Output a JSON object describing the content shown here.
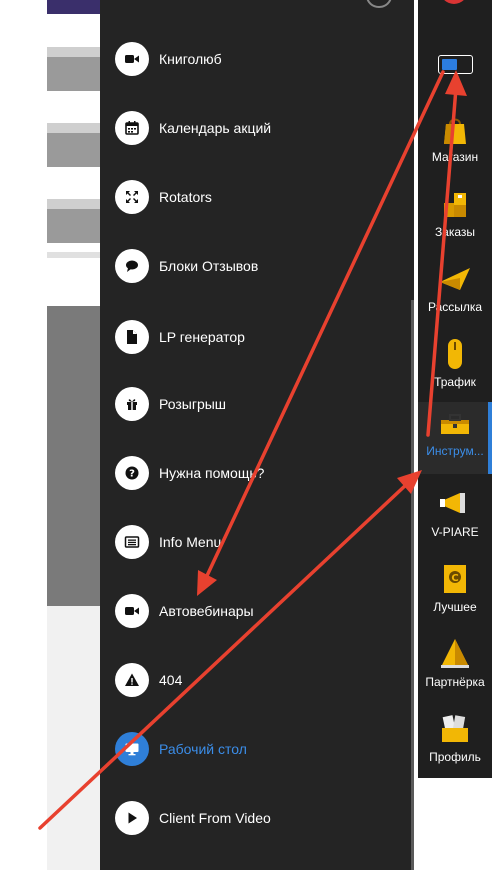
{
  "menu": {
    "items": [
      {
        "label": "Книголюб",
        "icon": "video-camera-icon"
      },
      {
        "label": "Календарь акций",
        "icon": "calendar-icon"
      },
      {
        "label": "Rotators",
        "icon": "expand-arrows-icon"
      },
      {
        "label": "Блоки Отзывов",
        "icon": "comments-icon"
      },
      {
        "label": "LP генератор",
        "icon": "file-icon"
      },
      {
        "label": "Розыгрыш",
        "icon": "gift-icon"
      },
      {
        "label": "Нужна помощь?",
        "icon": "question-icon"
      },
      {
        "label": "Info Menu",
        "icon": "list-icon"
      },
      {
        "label": "Автовебинары",
        "icon": "video-camera-icon"
      },
      {
        "label": "404",
        "icon": "warning-icon"
      },
      {
        "label": "Рабочий стол",
        "icon": "desktop-icon",
        "active": true
      },
      {
        "label": "Client From Video",
        "icon": "play-icon"
      }
    ]
  },
  "sidebar": {
    "items": [
      {
        "label": "Магазин",
        "icon": "shopping-bag-icon"
      },
      {
        "label": "Заказы",
        "icon": "boxes-icon"
      },
      {
        "label": "Рассылка",
        "icon": "paper-plane-icon"
      },
      {
        "label": "Трафик",
        "icon": "mouse-icon"
      },
      {
        "label": "Инструм...",
        "icon": "toolbox-icon",
        "active": true
      },
      {
        "label": "V-PIARE",
        "icon": "megaphone-icon"
      },
      {
        "label": "Лучшее",
        "icon": "trophy-icon"
      },
      {
        "label": "Партнёрка",
        "icon": "pyramid-icon"
      },
      {
        "label": "Профиль",
        "icon": "profile-files-icon"
      }
    ]
  },
  "colors": {
    "menu_bg": "#242424",
    "sidebar_bg": "#1f1f1f",
    "accent": "#3b8de8",
    "annotation_arrow": "#e8412f"
  }
}
